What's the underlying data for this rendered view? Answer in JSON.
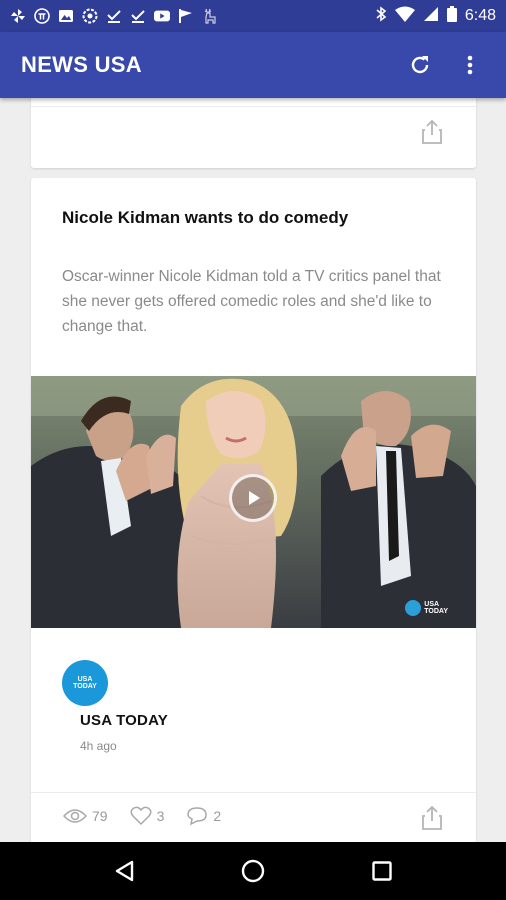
{
  "status_bar": {
    "time": "6:48",
    "left_icons": [
      "pinwheel-icon",
      "pi-icon",
      "gallery-icon",
      "settings-circle-icon",
      "check-icon",
      "check-icon",
      "youtube-icon",
      "flag-icon",
      "deer-icon"
    ],
    "right_icons": [
      "bluetooth-icon",
      "wifi-icon",
      "signal-icon",
      "battery-icon"
    ]
  },
  "app_bar": {
    "title": "NEWS USA",
    "actions": [
      "refresh-icon",
      "more-vert-icon"
    ]
  },
  "article": {
    "headline": "Nicole Kidman wants to do comedy",
    "summary": "Oscar-winner Nicole Kidman told a TV critics panel that she never gets offered comedic roles and she'd like to change that.",
    "media_watermark": [
      "USA",
      "TODAY"
    ],
    "source": {
      "logo_text": [
        "USA",
        "TODAY"
      ],
      "name": "USA TODAY",
      "time": "4h ago"
    },
    "stats": {
      "views": "79",
      "likes": "3",
      "comments": "2"
    }
  },
  "colors": {
    "status_bar": "#2f3d97",
    "app_bar": "#3949ab",
    "usa_today_blue": "#1a98da",
    "background": "#eeeeee"
  },
  "nav_bar": {
    "buttons": [
      "back-icon",
      "home-icon",
      "recents-icon"
    ]
  }
}
